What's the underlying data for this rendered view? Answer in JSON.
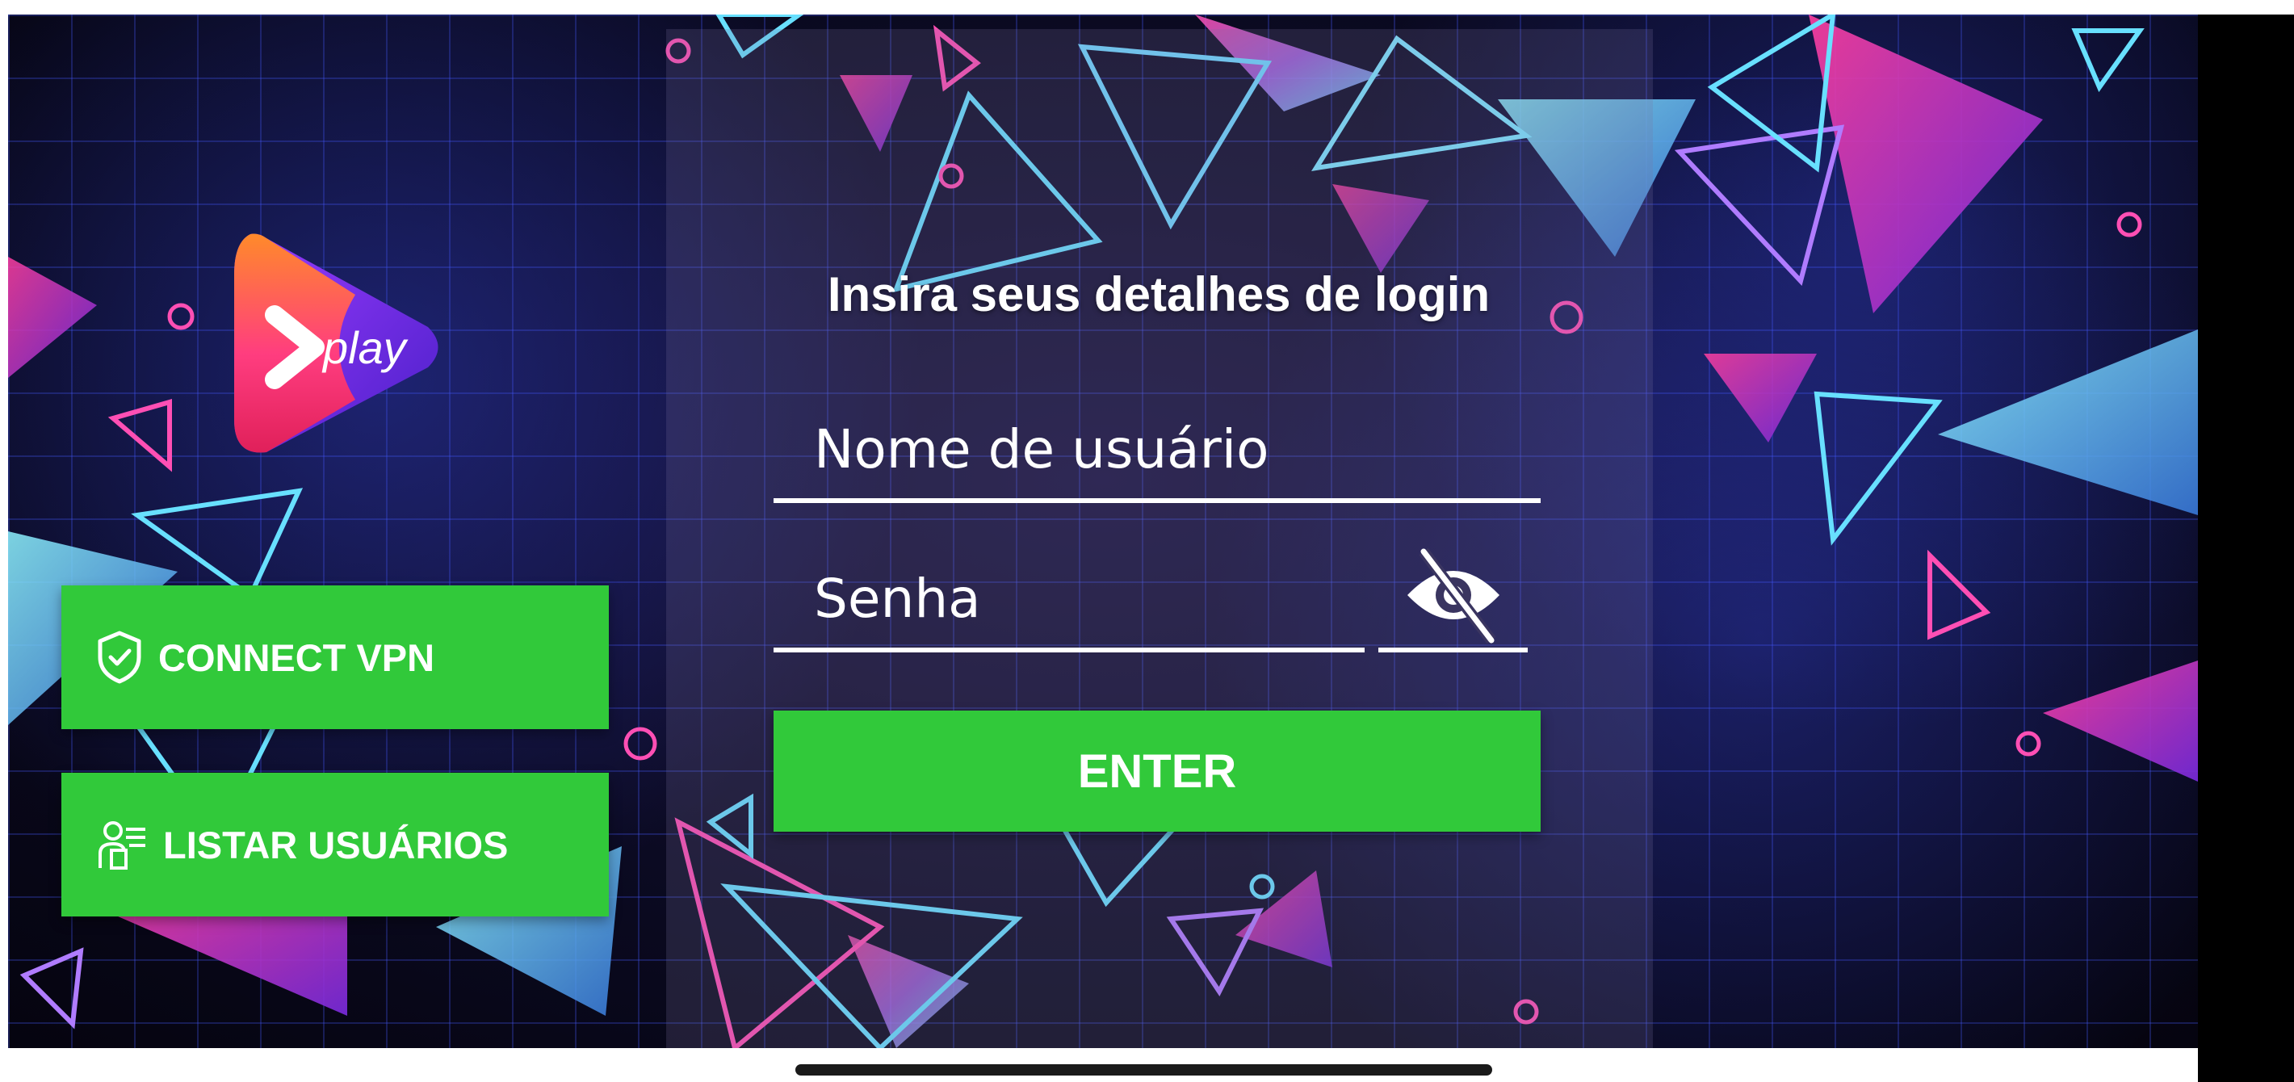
{
  "app": {
    "logo_text": "play",
    "colors": {
      "accent_green": "#31c93a",
      "text": "#ffffff"
    }
  },
  "side_buttons": {
    "vpn": {
      "label": "CONNECT VPN",
      "icon": "shield-check-icon"
    },
    "users": {
      "label": "LISTAR USUÁRIOS",
      "icon": "user-list-icon"
    }
  },
  "login": {
    "title": "Insira seus detalhes de login",
    "username_placeholder": "Nome de usuário",
    "password_placeholder": "Senha",
    "password_toggle_icon": "eye-off-icon",
    "enter_label": "ENTER"
  }
}
